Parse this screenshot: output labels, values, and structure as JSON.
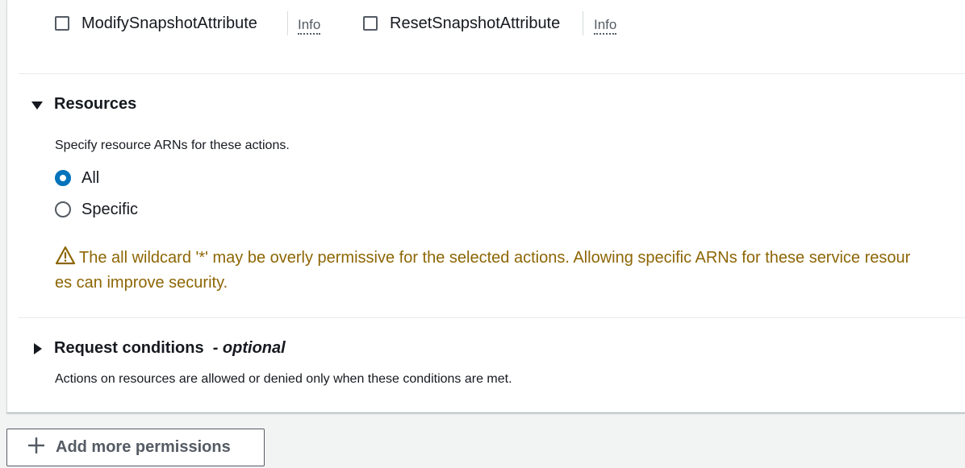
{
  "actions": [
    {
      "label": "ModifySnapshotAttribute",
      "info": "Info",
      "checked": false
    },
    {
      "label": "ResetSnapshotAttribute",
      "info": "Info",
      "checked": false
    }
  ],
  "resources": {
    "title": "Resources",
    "expanded": true,
    "description": "Specify resource ARNs for these actions.",
    "options": [
      {
        "label": "All",
        "selected": true
      },
      {
        "label": "Specific",
        "selected": false
      }
    ],
    "warning_line1": "The all wildcard '*' may be overly permissive for the selected actions. Allowing specific ARNs for these service resour",
    "warning_line2": "es can improve security.",
    "warning_color": "#8d6605"
  },
  "request_conditions": {
    "title": "Request conditions",
    "optional": "- optional",
    "expanded": false,
    "description": "Actions on resources are allowed or denied only when these conditions are met."
  },
  "add_more_permissions": {
    "label": "Add more permissions",
    "icon": "plus-icon"
  },
  "colors": {
    "accent": "#0073bb",
    "text": "#16191f",
    "secondary_text": "#545b64"
  }
}
